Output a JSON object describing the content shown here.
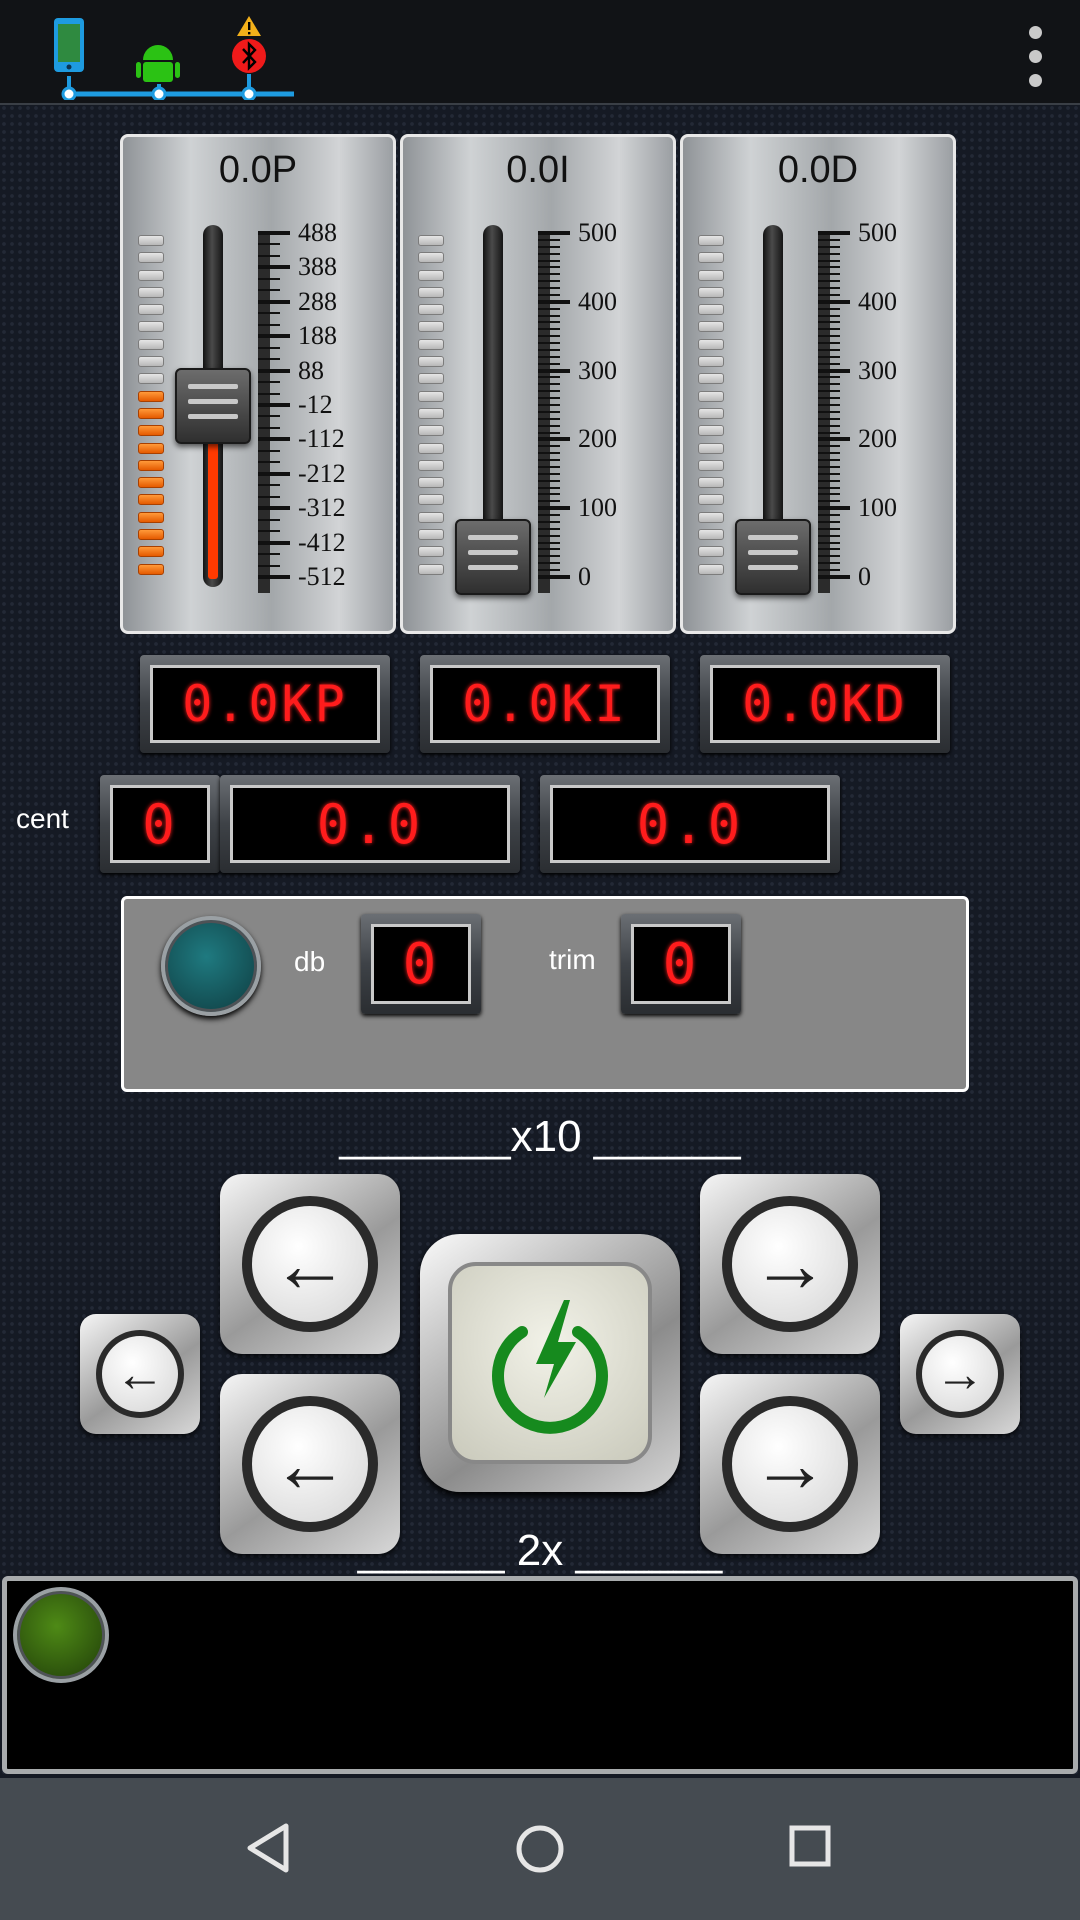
{
  "status_bar": {
    "icons": [
      "phone-icon",
      "android-icon",
      "bluetooth-icon"
    ],
    "warning_icon": "warning-icon",
    "accent_color": "#1e9be0",
    "menu_icon": "overflow-menu-icon"
  },
  "sliders": [
    {
      "title": "0.0P",
      "ticks": [
        "488",
        "388",
        "288",
        "188",
        "88",
        "-12",
        "-112",
        "-212",
        "-312",
        "-412",
        "-512"
      ],
      "level": 0.5,
      "lit_leds": 11,
      "total_leds": 20
    },
    {
      "title": "0.0I",
      "ticks": [
        "500",
        "400",
        "300",
        "200",
        "100",
        "0"
      ],
      "level": 0.0,
      "lit_leds": 0,
      "total_leds": 20
    },
    {
      "title": "0.0D",
      "ticks": [
        "500",
        "400",
        "300",
        "200",
        "100",
        "0"
      ],
      "level": 0.0,
      "lit_leds": 0,
      "total_leds": 20
    }
  ],
  "lcd_displays": {
    "kp": "0.0KP",
    "ki": "0.0KI",
    "kd": "0.0KD"
  },
  "cent_row": {
    "label": "cent",
    "value": "0",
    "value2": "0.0",
    "value3": "0.0"
  },
  "db_panel": {
    "db_label": "db",
    "db_value": "0",
    "trim_label": "trim",
    "trim_value": "0",
    "indicator_color": "#1f7a80"
  },
  "controls": {
    "top_label": "_______x10 ______",
    "bottom_label": "______ 2x ______",
    "left_arrow": "←",
    "right_arrow": "→",
    "power_icon": "power-icon",
    "power_color": "#168a1e"
  },
  "console": {
    "indicator_color": "#4e8a16"
  },
  "nav": {
    "back_icon": "back-icon",
    "home_icon": "home-icon",
    "recents_icon": "recents-icon"
  }
}
